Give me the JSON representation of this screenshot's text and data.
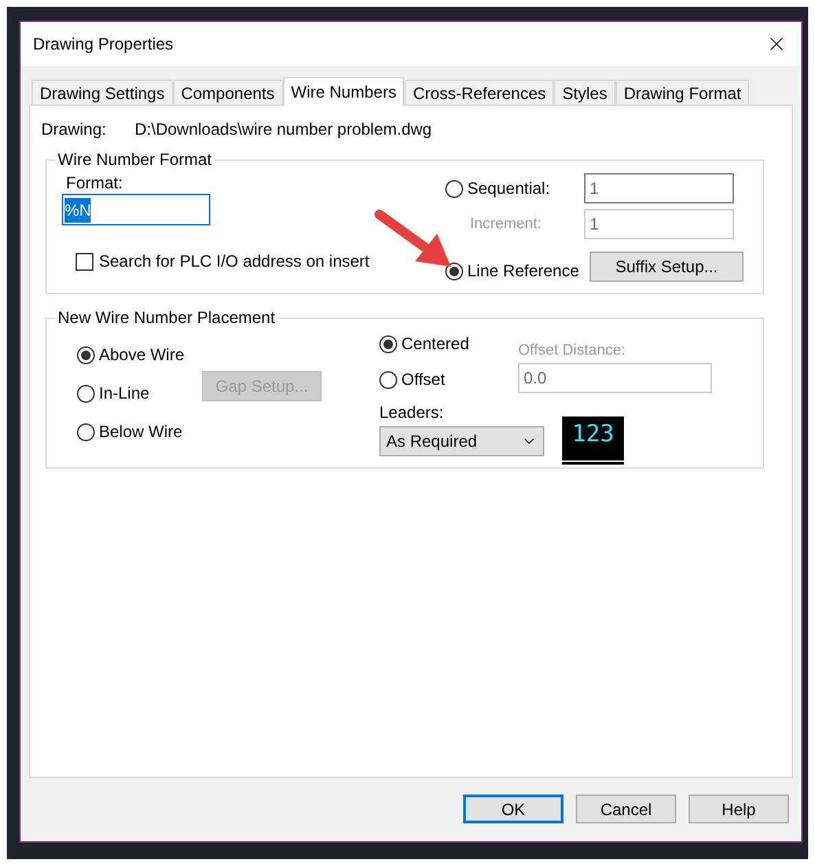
{
  "window": {
    "title": "Drawing Properties"
  },
  "tabs": [
    {
      "label": "Drawing Settings",
      "selected": false
    },
    {
      "label": "Components",
      "selected": false
    },
    {
      "label": "Wire Numbers",
      "selected": true
    },
    {
      "label": "Cross-References",
      "selected": false
    },
    {
      "label": "Styles",
      "selected": false
    },
    {
      "label": "Drawing Format",
      "selected": false
    }
  ],
  "drawing": {
    "label": "Drawing:",
    "value": "D:\\Downloads\\wire number problem.dwg"
  },
  "wire_number_format": {
    "title": "Wire Number Format",
    "format_label": "Format:",
    "format_value": "%N",
    "format_selected": true,
    "plc_search": {
      "label": "Search for PLC I/O address on insert",
      "checked": false
    },
    "sequential": {
      "label": "Sequential:",
      "selected": false,
      "value": "1"
    },
    "increment": {
      "label": "Increment:",
      "value": "1",
      "disabled": true
    },
    "line_reference": {
      "label": "Line Reference",
      "selected": true
    },
    "suffix_button": "Suffix Setup..."
  },
  "placement": {
    "title": "New Wire Number Placement",
    "positions": [
      {
        "label": "Above Wire",
        "selected": true
      },
      {
        "label": "In-Line",
        "selected": false
      },
      {
        "label": "Below Wire",
        "selected": false
      }
    ],
    "gap_button": {
      "label": "Gap Setup...",
      "disabled": true
    },
    "alignment": [
      {
        "label": "Centered",
        "selected": true
      },
      {
        "label": "Offset",
        "selected": false
      }
    ],
    "offset_distance": {
      "label": "Offset Distance:",
      "value": "0.0",
      "disabled": true
    },
    "leaders": {
      "label": "Leaders:",
      "value": "As Required"
    },
    "preview": "123"
  },
  "buttons": [
    {
      "label": "OK",
      "default": true
    },
    {
      "label": "Cancel",
      "default": false
    },
    {
      "label": "Help",
      "default": false
    }
  ]
}
